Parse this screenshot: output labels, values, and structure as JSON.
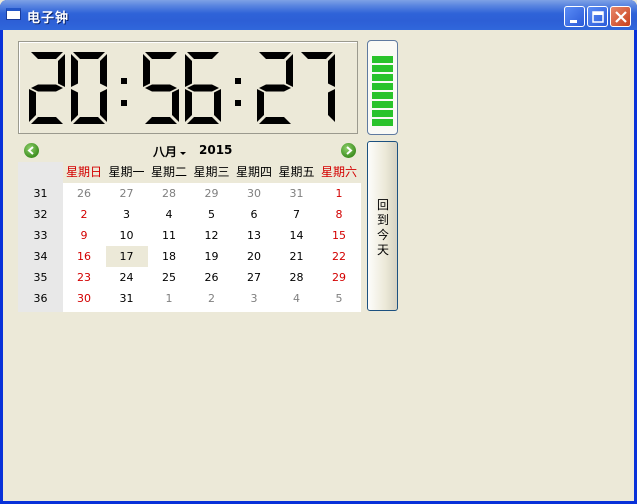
{
  "window": {
    "title": "电子钟"
  },
  "clock": {
    "hours": "20",
    "minutes": "56",
    "seconds": "27",
    "separator": ":"
  },
  "level_bar": {
    "segments_filled": 8,
    "segments_total": 9,
    "color": "#29c32b"
  },
  "calendar": {
    "month": "八月",
    "year": "2015",
    "weekday_headers": [
      "星期日",
      "星期一",
      "星期二",
      "星期三",
      "星期四",
      "星期五",
      "星期六"
    ],
    "weeks": [
      {
        "num": "31",
        "days": [
          {
            "d": "26",
            "t": "gray"
          },
          {
            "d": "27",
            "t": "gray"
          },
          {
            "d": "28",
            "t": "gray"
          },
          {
            "d": "29",
            "t": "gray"
          },
          {
            "d": "30",
            "t": "gray"
          },
          {
            "d": "31",
            "t": "gray"
          },
          {
            "d": "1",
            "t": "red"
          }
        ]
      },
      {
        "num": "32",
        "days": [
          {
            "d": "2",
            "t": "red"
          },
          {
            "d": "3",
            "t": ""
          },
          {
            "d": "4",
            "t": ""
          },
          {
            "d": "5",
            "t": ""
          },
          {
            "d": "6",
            "t": ""
          },
          {
            "d": "7",
            "t": ""
          },
          {
            "d": "8",
            "t": "red"
          }
        ]
      },
      {
        "num": "33",
        "days": [
          {
            "d": "9",
            "t": "red"
          },
          {
            "d": "10",
            "t": ""
          },
          {
            "d": "11",
            "t": ""
          },
          {
            "d": "12",
            "t": ""
          },
          {
            "d": "13",
            "t": ""
          },
          {
            "d": "14",
            "t": ""
          },
          {
            "d": "15",
            "t": "red"
          }
        ]
      },
      {
        "num": "34",
        "days": [
          {
            "d": "16",
            "t": "red"
          },
          {
            "d": "17",
            "t": "today"
          },
          {
            "d": "18",
            "t": ""
          },
          {
            "d": "19",
            "t": ""
          },
          {
            "d": "20",
            "t": ""
          },
          {
            "d": "21",
            "t": ""
          },
          {
            "d": "22",
            "t": "red"
          }
        ]
      },
      {
        "num": "35",
        "days": [
          {
            "d": "23",
            "t": "red"
          },
          {
            "d": "24",
            "t": ""
          },
          {
            "d": "25",
            "t": ""
          },
          {
            "d": "26",
            "t": ""
          },
          {
            "d": "27",
            "t": ""
          },
          {
            "d": "28",
            "t": ""
          },
          {
            "d": "29",
            "t": "red"
          }
        ]
      },
      {
        "num": "36",
        "days": [
          {
            "d": "30",
            "t": "red"
          },
          {
            "d": "31",
            "t": ""
          },
          {
            "d": "1",
            "t": "gray"
          },
          {
            "d": "2",
            "t": "gray"
          },
          {
            "d": "3",
            "t": "gray"
          },
          {
            "d": "4",
            "t": "gray"
          },
          {
            "d": "5",
            "t": "gray"
          }
        ]
      }
    ]
  },
  "today_button": {
    "label": "回到今天"
  },
  "colors": {
    "weekend": "#d30000",
    "other_month": "#808080",
    "title_bar": "#2f63d8"
  }
}
